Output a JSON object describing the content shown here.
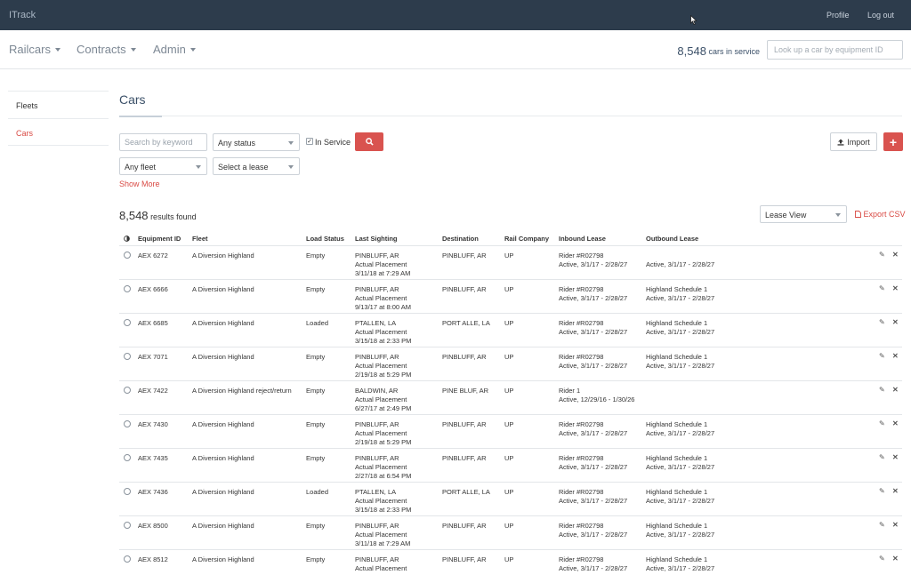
{
  "app": {
    "brand": "ITrack"
  },
  "topnav": {
    "profile": "Profile",
    "logout": "Log out"
  },
  "mainnav": {
    "railcars": "Railcars",
    "contracts": "Contracts",
    "admin": "Admin"
  },
  "service": {
    "count": "8,548",
    "label": "cars in service"
  },
  "lookup": {
    "placeholder": "Look up a car by equipment ID"
  },
  "sidebar": {
    "items": [
      {
        "label": "Fleets"
      },
      {
        "label": "Cars"
      }
    ]
  },
  "page": {
    "title": "Cars"
  },
  "filters": {
    "keyword_placeholder": "Search by keyword",
    "status": "Any status",
    "in_service_label": "In Service",
    "fleet": "Any fleet",
    "lease": "Select a lease",
    "show_more": "Show More",
    "import_label": "Import"
  },
  "results": {
    "count": "8,548",
    "label": "results found",
    "view": "Lease View",
    "export": "Export CSV"
  },
  "table": {
    "headers": [
      "Equipment ID",
      "Fleet",
      "Load Status",
      "Last Sighting",
      "Destination",
      "Rail Company",
      "Inbound Lease",
      "Outbound Lease"
    ],
    "rows": [
      {
        "id": "AEX 6272",
        "fleet": "A Diversion Highland",
        "load": "Empty",
        "s1": "PINBLUFF, AR",
        "s2": "Actual Placement",
        "s3": "3/11/18 at 7:29 AM",
        "dest": "PINBLUFF, AR",
        "rail": "UP",
        "in1": "Rider #R02798",
        "in2": "Active, 3/1/17 - 2/28/27",
        "out1": "",
        "out2": "Active, 3/1/17 - 2/28/27"
      },
      {
        "id": "AEX 6666",
        "fleet": "A Diversion Highland",
        "load": "Empty",
        "s1": "PINBLUFF, AR",
        "s2": "Actual Placement",
        "s3": "9/13/17 at 8:00 AM",
        "dest": "PINBLUFF, AR",
        "rail": "UP",
        "in1": "Rider #R02798",
        "in2": "Active, 3/1/17 - 2/28/27",
        "out1": "Highland Schedule 1",
        "out2": "Active, 3/1/17 - 2/28/27"
      },
      {
        "id": "AEX 6685",
        "fleet": "A Diversion Highland",
        "load": "Loaded",
        "s1": "PTALLEN, LA",
        "s2": "Actual Placement",
        "s3": "3/15/18 at 2:33 PM",
        "dest": "PORT ALLE, LA",
        "rail": "UP",
        "in1": "Rider #R02798",
        "in2": "Active, 3/1/17 - 2/28/27",
        "out1": "Highland Schedule 1",
        "out2": "Active, 3/1/17 - 2/28/27"
      },
      {
        "id": "AEX 7071",
        "fleet": "A Diversion Highland",
        "load": "Empty",
        "s1": "PINBLUFF, AR",
        "s2": "Actual Placement",
        "s3": "2/19/18 at 5:29 PM",
        "dest": "PINBLUFF, AR",
        "rail": "UP",
        "in1": "Rider #R02798",
        "in2": "Active, 3/1/17 - 2/28/27",
        "out1": "Highland Schedule 1",
        "out2": "Active, 3/1/17 - 2/28/27"
      },
      {
        "id": "AEX 7422",
        "fleet": "A Diversion Highland reject/return",
        "load": "Empty",
        "s1": "BALDWIN, AR",
        "s2": "Actual Placement",
        "s3": "6/27/17 at 2:49 PM",
        "dest": "PINE BLUF, AR",
        "rail": "UP",
        "in1": "Rider 1",
        "in2": "Active, 12/29/16 - 1/30/26",
        "out1": "",
        "out2": ""
      },
      {
        "id": "AEX 7430",
        "fleet": "A Diversion Highland",
        "load": "Empty",
        "s1": "PINBLUFF, AR",
        "s2": "Actual Placement",
        "s3": "2/19/18 at 5:29 PM",
        "dest": "PINBLUFF, AR",
        "rail": "UP",
        "in1": "Rider #R02798",
        "in2": "Active, 3/1/17 - 2/28/27",
        "out1": "Highland Schedule 1",
        "out2": "Active, 3/1/17 - 2/28/27"
      },
      {
        "id": "AEX 7435",
        "fleet": "A Diversion Highland",
        "load": "Empty",
        "s1": "PINBLUFF, AR",
        "s2": "Actual Placement",
        "s3": "2/27/18 at 6:54 PM",
        "dest": "PINBLUFF, AR",
        "rail": "UP",
        "in1": "Rider #R02798",
        "in2": "Active, 3/1/17 - 2/28/27",
        "out1": "Highland Schedule 1",
        "out2": "Active, 3/1/17 - 2/28/27"
      },
      {
        "id": "AEX 7436",
        "fleet": "A Diversion Highland",
        "load": "Loaded",
        "s1": "PTALLEN, LA",
        "s2": "Actual Placement",
        "s3": "3/15/18 at 2:33 PM",
        "dest": "PORT ALLE, LA",
        "rail": "UP",
        "in1": "Rider #R02798",
        "in2": "Active, 3/1/17 - 2/28/27",
        "out1": "Highland Schedule 1",
        "out2": "Active, 3/1/17 - 2/28/27"
      },
      {
        "id": "AEX 8500",
        "fleet": "A Diversion Highland",
        "load": "Empty",
        "s1": "PINBLUFF, AR",
        "s2": "Actual Placement",
        "s3": "3/11/18 at 7:29 AM",
        "dest": "PINBLUFF, AR",
        "rail": "UP",
        "in1": "Rider #R02798",
        "in2": "Active, 3/1/17 - 2/28/27",
        "out1": "Highland Schedule 1",
        "out2": "Active, 3/1/17 - 2/28/27"
      },
      {
        "id": "AEX 8512",
        "fleet": "A Diversion Highland",
        "load": "Empty",
        "s1": "PINBLUFF, AR",
        "s2": "Actual Placement",
        "s3": "",
        "dest": "PINBLUFF, AR",
        "rail": "UP",
        "in1": "Rider #R02798",
        "in2": "Active, 3/1/17 - 2/28/27",
        "out1": "Highland Schedule 1",
        "out2": "Active, 3/1/17 - 2/28/27"
      }
    ]
  },
  "colors": {
    "topbar": "#2d3c4c",
    "accent": "#d9534f",
    "title": "#3b5068"
  }
}
